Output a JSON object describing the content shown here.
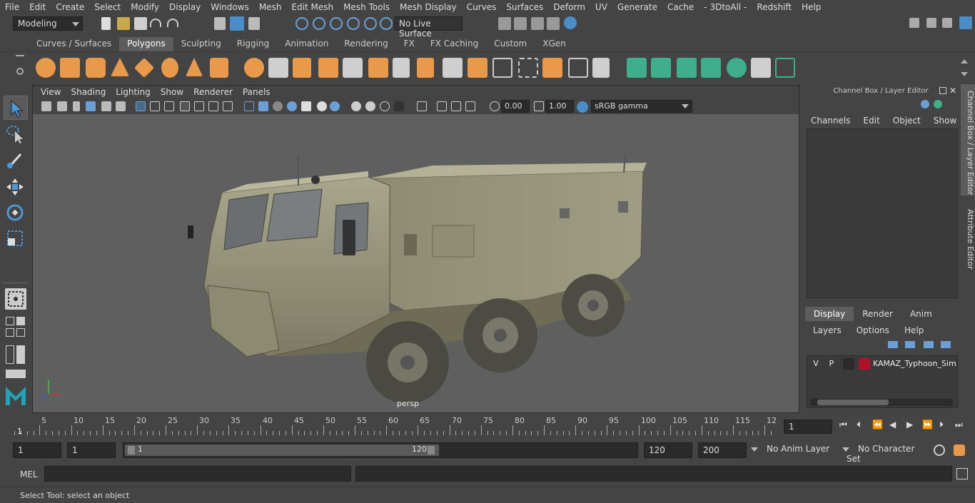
{
  "menubar": {
    "items": [
      "File",
      "Edit",
      "Create",
      "Select",
      "Modify",
      "Display",
      "Windows",
      "Mesh",
      "Edit Mesh",
      "Mesh Tools",
      "Mesh Display",
      "Curves",
      "Surfaces",
      "Deform",
      "UV",
      "Generate",
      "Cache",
      "- 3DtoAll -",
      "Redshift",
      "Help"
    ]
  },
  "statusline": {
    "mode": "Modeling",
    "live_surface": "No Live Surface"
  },
  "shelf": {
    "tabs": [
      "Curves / Surfaces",
      "Polygons",
      "Sculpting",
      "Rigging",
      "Animation",
      "Rendering",
      "FX",
      "FX Caching",
      "Custom",
      "XGen"
    ],
    "active_tab": "Polygons"
  },
  "viewport_panel": {
    "menus": [
      "View",
      "Shading",
      "Lighting",
      "Show",
      "Renderer",
      "Panels"
    ],
    "exposure": "0.00",
    "gamma": "1.00",
    "color_space": "sRGB gamma",
    "camera_label": "persp"
  },
  "channel_box": {
    "title": "Channel Box / Layer Editor",
    "menus": [
      "Channels",
      "Edit",
      "Object",
      "Show"
    ]
  },
  "layer_editor": {
    "tabs": [
      "Display",
      "Render",
      "Anim"
    ],
    "active_tab": "Display",
    "menus": [
      "Layers",
      "Options",
      "Help"
    ],
    "layer": {
      "visible": "V",
      "playback": "P",
      "name": "KAMAZ_Typhoon_Simp",
      "color": "#b0102a"
    }
  },
  "side_tabs": {
    "channel_box": "Channel Box / Layer Editor",
    "attribute_editor": "Attribute Editor"
  },
  "timeline": {
    "labels": [
      "5",
      "10",
      "15",
      "20",
      "25",
      "30",
      "35",
      "40",
      "45",
      "50",
      "55",
      "60",
      "65",
      "70",
      "75",
      "80",
      "85",
      "90",
      "95",
      "100",
      "105",
      "110",
      "115",
      "12"
    ],
    "start_marker": "1",
    "current_frame": "1"
  },
  "range": {
    "start": "1",
    "playback_start": "1",
    "slider_start": "1",
    "slider_end": "120",
    "playback_end": "120",
    "end": "200",
    "anim_layer": "No Anim Layer",
    "character_set": "No Character Set"
  },
  "command_line": {
    "lang": "MEL"
  },
  "help_line": {
    "text": "Select Tool: select an object"
  },
  "colors": {
    "accent_blue": "#4a8ec9",
    "shelf_orange": "#e89a4a",
    "shelf_green": "#3fae8c",
    "viewport_bg": "#5f5f5f"
  }
}
